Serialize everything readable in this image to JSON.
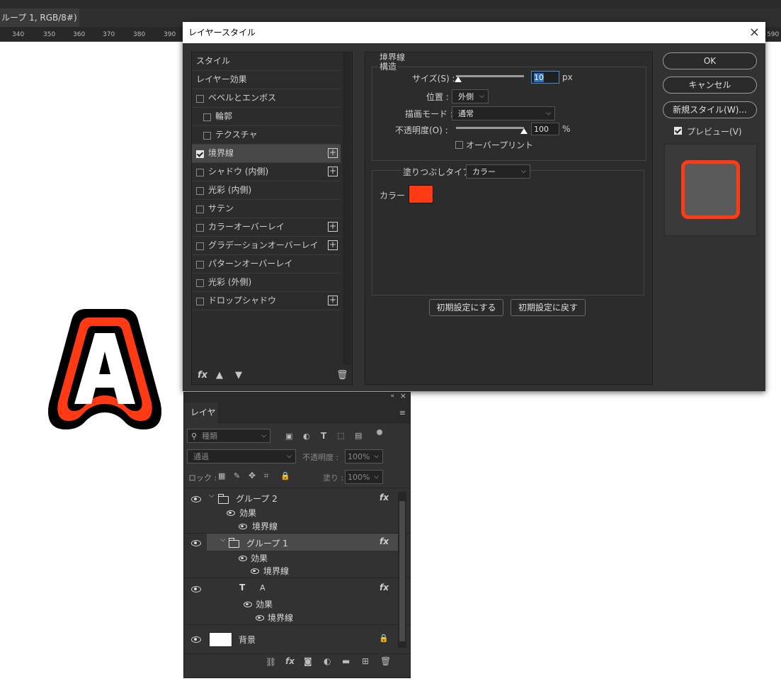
{
  "app": {
    "doc_tab": "ループ 1, RGB/8#) *",
    "doc_tab_close": "×",
    "ruler_ticks": [
      "340",
      "350",
      "360",
      "370",
      "380",
      "390",
      "590"
    ]
  },
  "dialog": {
    "title": "レイヤースタイル",
    "close": "×",
    "style_list": {
      "items": [
        {
          "label": "スタイル",
          "checkbox": false,
          "checked": false,
          "plus": false,
          "indent": 0,
          "selected": false
        },
        {
          "label": "レイヤー効果",
          "checkbox": false,
          "checked": false,
          "plus": false,
          "indent": 0,
          "selected": false
        },
        {
          "label": "ベベルとエンボス",
          "checkbox": true,
          "checked": false,
          "plus": false,
          "indent": 0,
          "selected": false
        },
        {
          "label": "輪郭",
          "checkbox": true,
          "checked": false,
          "plus": false,
          "indent": 1,
          "selected": false
        },
        {
          "label": "テクスチャ",
          "checkbox": true,
          "checked": false,
          "plus": false,
          "indent": 1,
          "selected": false
        },
        {
          "label": "境界線",
          "checkbox": true,
          "checked": true,
          "plus": true,
          "indent": 0,
          "selected": true
        },
        {
          "label": "シャドウ (内側)",
          "checkbox": true,
          "checked": false,
          "plus": true,
          "indent": 0,
          "selected": false
        },
        {
          "label": "光彩 (内側)",
          "checkbox": true,
          "checked": false,
          "plus": false,
          "indent": 0,
          "selected": false
        },
        {
          "label": "サテン",
          "checkbox": true,
          "checked": false,
          "plus": false,
          "indent": 0,
          "selected": false
        },
        {
          "label": "カラーオーバーレイ",
          "checkbox": true,
          "checked": false,
          "plus": true,
          "indent": 0,
          "selected": false
        },
        {
          "label": "グラデーションオーバーレイ",
          "checkbox": true,
          "checked": false,
          "plus": true,
          "indent": 0,
          "selected": false
        },
        {
          "label": "パターンオーバーレイ",
          "checkbox": true,
          "checked": false,
          "plus": false,
          "indent": 0,
          "selected": false
        },
        {
          "label": "光彩 (外側)",
          "checkbox": true,
          "checked": false,
          "plus": false,
          "indent": 0,
          "selected": false
        },
        {
          "label": "ドロップシャドウ",
          "checkbox": true,
          "checked": false,
          "plus": true,
          "indent": 0,
          "selected": false
        }
      ],
      "bottom_icons": [
        "fx-icon",
        "arrow-up-icon",
        "arrow-down-icon",
        "trash-icon"
      ]
    },
    "stroke": {
      "section_title": "境界線",
      "structure_title": "構造",
      "size_label": "サイズ(S) :",
      "size_value": "10",
      "size_unit": "px",
      "position_label": "位置 :",
      "position_value": "外側",
      "blend_label": "描画モード :",
      "blend_value": "通常",
      "opacity_label": "不透明度(O) :",
      "opacity_value": "100",
      "opacity_unit": "%",
      "overprint_label": "オーバープリント",
      "overprint_checked": false,
      "size_slider_fraction": 0.03,
      "opacity_slider_fraction": 1.0,
      "fill_type_label": "塗りつぶしタイプ :",
      "fill_type_value": "カラー",
      "color_label": "カラー :",
      "color_value": "#ff3a14",
      "reset_default": "初期設定にする",
      "restore_default": "初期設定に戻す"
    },
    "buttons": {
      "ok": "OK",
      "cancel": "キャンセル",
      "new_style": "新規スタイル(W)...",
      "preview_label": "プレビュー(V)",
      "preview_checked": true
    }
  },
  "layers_panel": {
    "tab": "レイヤー",
    "filter_placeholder": "種類",
    "blend_mode": "通過",
    "opacity_label": "不透明度 :",
    "opacity_value": "100%",
    "lock_label": "ロック :",
    "fill_label": "塗り :",
    "fill_value": "100%",
    "layers": [
      {
        "name": "グループ 2",
        "type": "group",
        "effects_label": "効果",
        "effect": "境界線",
        "fx": "fx"
      },
      {
        "name": "グループ 1",
        "type": "group",
        "effects_label": "効果",
        "effect": "境界線",
        "fx": "fx",
        "selected": true
      },
      {
        "name": "A",
        "type": "text",
        "type_icon": "T",
        "effects_label": "効果",
        "effect": "境界線",
        "fx": "fx"
      },
      {
        "name": "背景",
        "type": "background",
        "locked": true
      }
    ]
  },
  "colors": {
    "stroke_red": "#ff3a14",
    "dialog_bg": "#323232",
    "accent_blue": "#3f8edc"
  }
}
